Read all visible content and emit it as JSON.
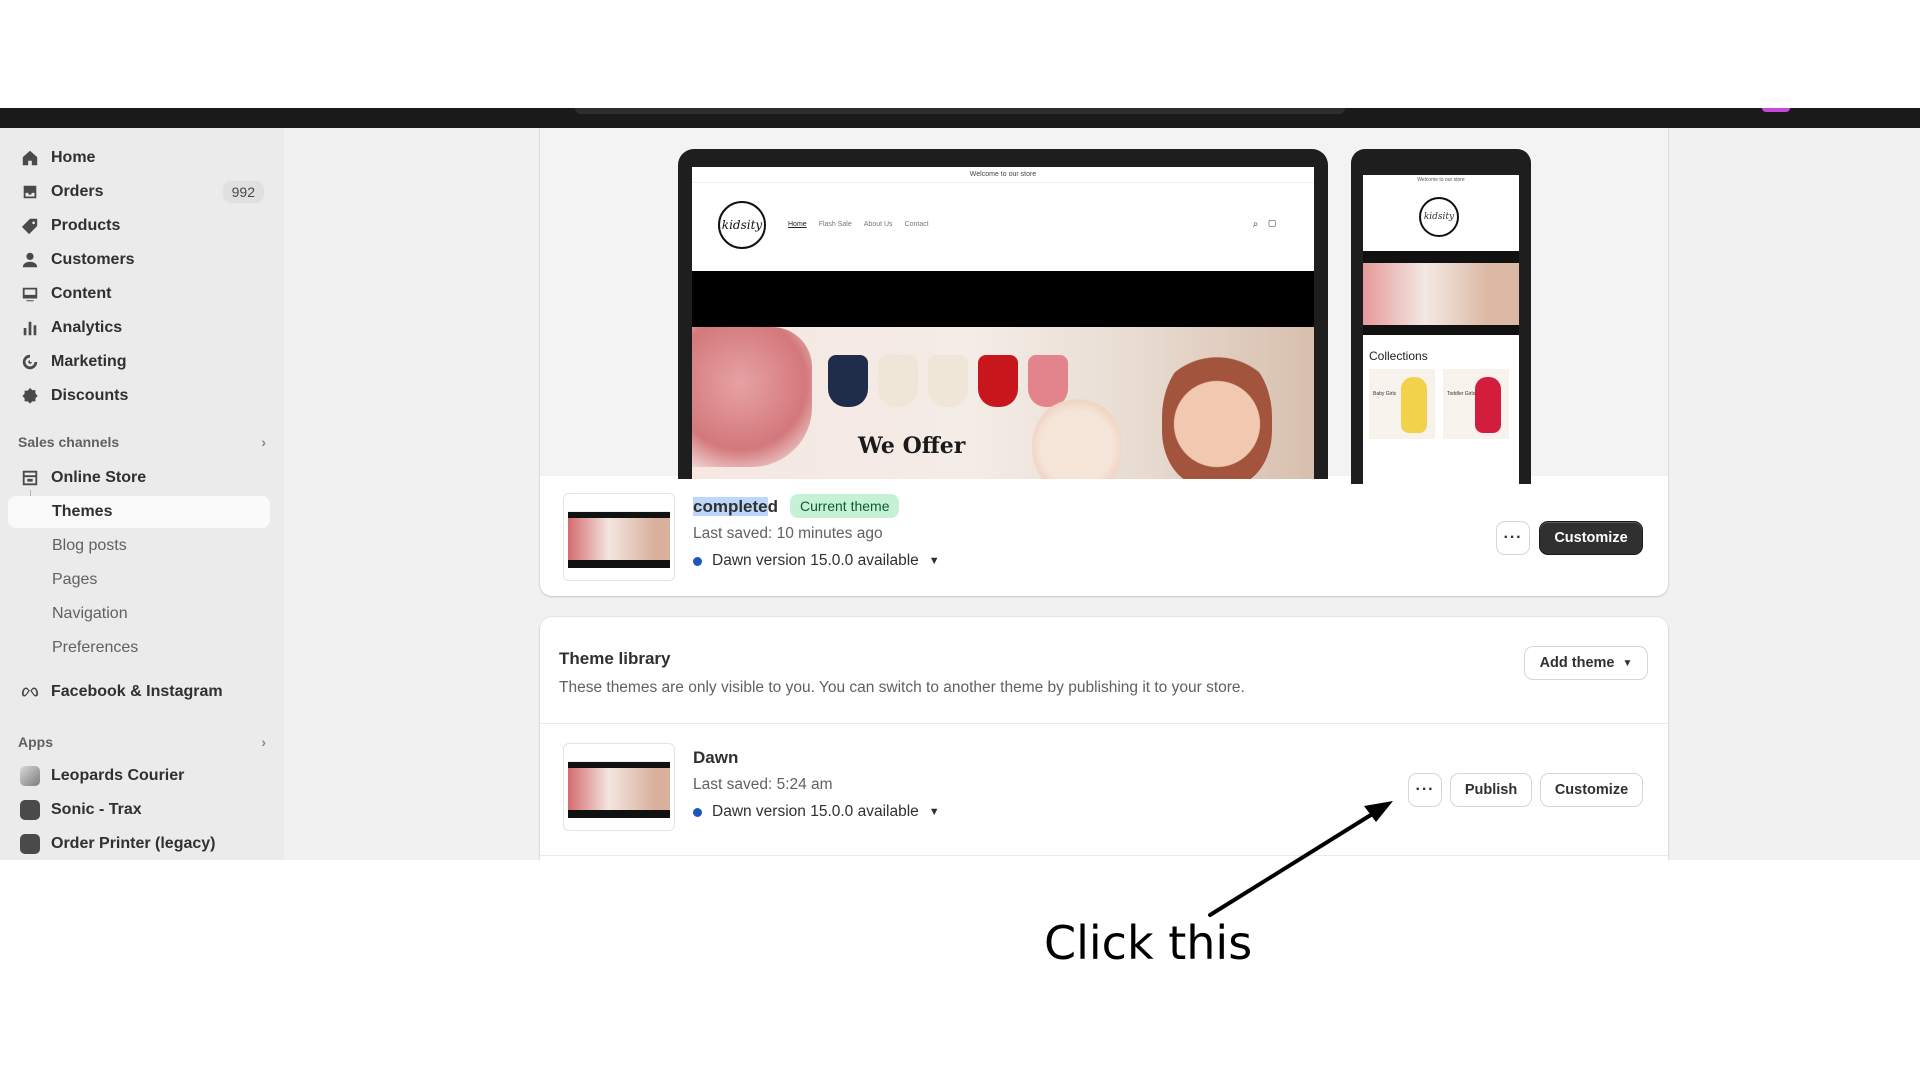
{
  "sidebar": {
    "main_items": [
      {
        "label": "Home",
        "icon": "home-icon"
      },
      {
        "label": "Orders",
        "icon": "orders-icon",
        "badge": "992"
      },
      {
        "label": "Products",
        "icon": "tag-icon"
      },
      {
        "label": "Customers",
        "icon": "person-icon"
      },
      {
        "label": "Content",
        "icon": "content-icon"
      },
      {
        "label": "Analytics",
        "icon": "bar-chart-icon"
      },
      {
        "label": "Marketing",
        "icon": "target-icon"
      },
      {
        "label": "Discounts",
        "icon": "discount-icon"
      }
    ],
    "sales_channels_label": "Sales channels",
    "online_store": {
      "label": "Online Store",
      "sub_items": [
        "Themes",
        "Blog posts",
        "Pages",
        "Navigation",
        "Preferences"
      ]
    },
    "facebook_label": "Facebook & Instagram",
    "apps_label": "Apps",
    "apps": [
      "Leopards Courier",
      "Sonic - Trax",
      "Order Printer (legacy)"
    ]
  },
  "preview": {
    "announcement": "Welcome to our store",
    "logo_text": "kidsity",
    "nav": [
      "Home",
      "Flash Sale",
      "About Us",
      "Contact"
    ],
    "hero_heading": "We Offer",
    "phone_collections": "Collections",
    "phone_tiles": [
      "Baby Girls",
      "Toddler Girls"
    ]
  },
  "current_theme": {
    "name_selected": "complete",
    "name_rest": "d",
    "badge": "Current theme",
    "last_saved": "Last saved: 10 minutes ago",
    "version": "Dawn version 15.0.0 available",
    "customize_label": "Customize",
    "more_label": "···"
  },
  "library": {
    "title": "Theme library",
    "description": "These themes are only visible to you. You can switch to another theme by publishing it to your store.",
    "add_theme_label": "Add theme",
    "themes": [
      {
        "name": "Dawn",
        "last_saved": "Last saved: 5:24 am",
        "version": "Dawn version 15.0.0 available",
        "more_label": "···",
        "publish_label": "Publish",
        "customize_label": "Customize"
      }
    ]
  },
  "annotation": {
    "text": "Click this"
  },
  "colors": {
    "accent_dark": "#303030",
    "current_badge_bg": "#c7f1d6",
    "version_dot": "#1d57b8",
    "selection": "#bcd7fa"
  }
}
